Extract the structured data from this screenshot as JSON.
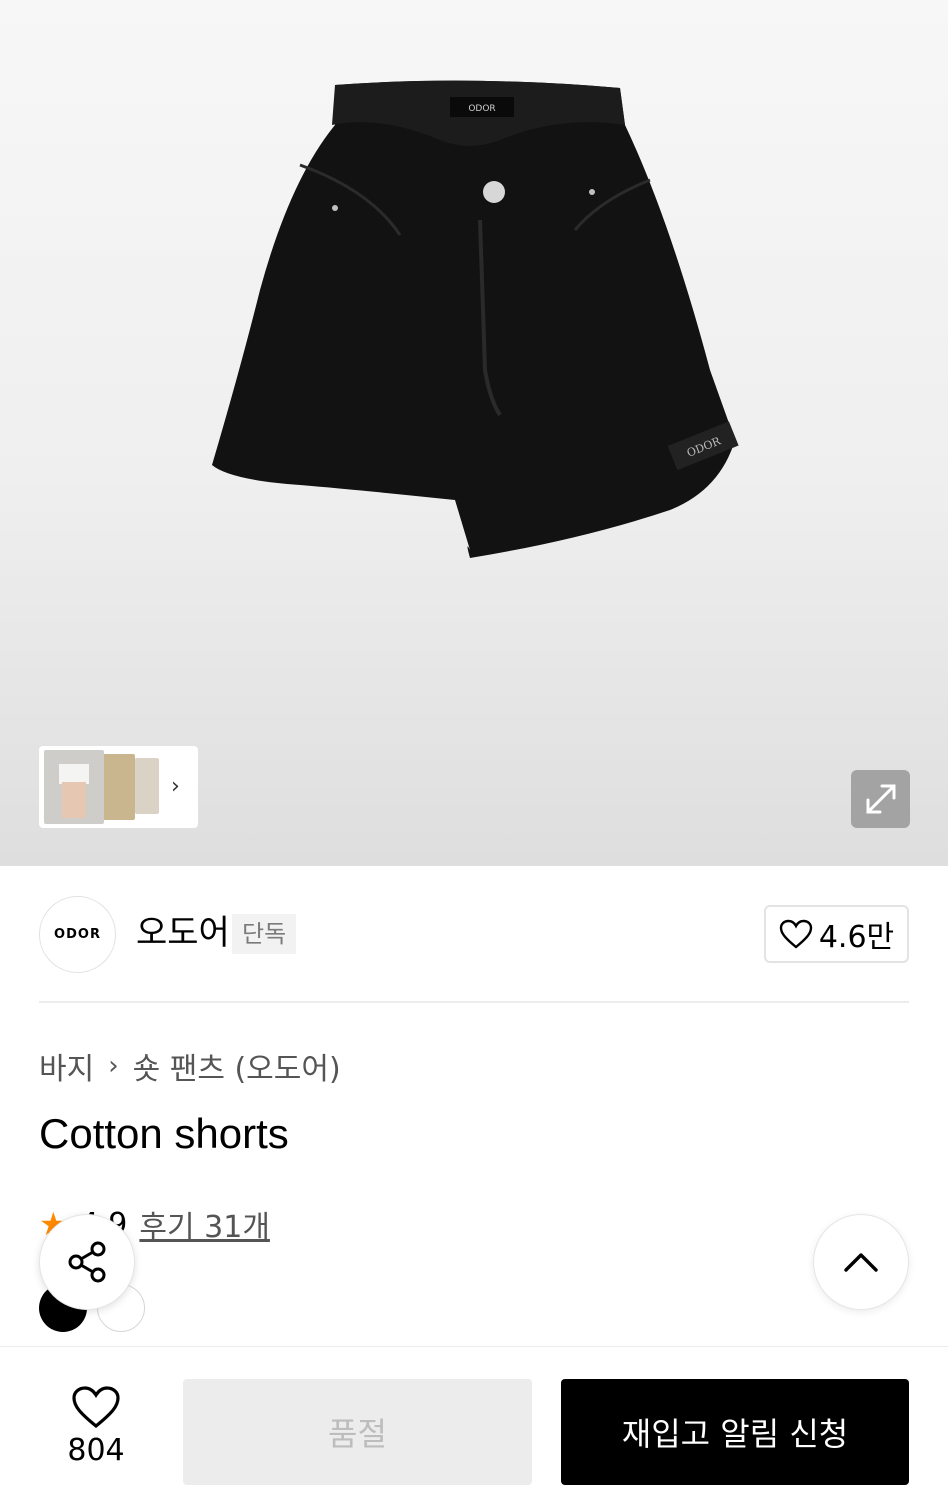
{
  "hero": {
    "image_alt": "black cotton shorts",
    "waist_label": "ODOR",
    "patch_label": "ODOR"
  },
  "brand": {
    "logo_text": "ODOR",
    "name": "오도어",
    "badge": "단독",
    "like_count": "4.6만"
  },
  "product": {
    "breadcrumb": [
      "바지",
      "숏 팬츠 (오도어)"
    ],
    "title": "Cotton shorts",
    "rating": "4.9",
    "reviews_label": "후기 31개",
    "colors": [
      "#000000",
      "#ffffff"
    ]
  },
  "bottom_bar": {
    "wish_count": "804",
    "soldout_label": "품절",
    "restock_label": "재입고 알림 신청"
  },
  "icons": {
    "share": "share-icon",
    "scroll_top": "chevron-up-icon",
    "expand": "expand-icon",
    "heart": "heart-icon"
  }
}
